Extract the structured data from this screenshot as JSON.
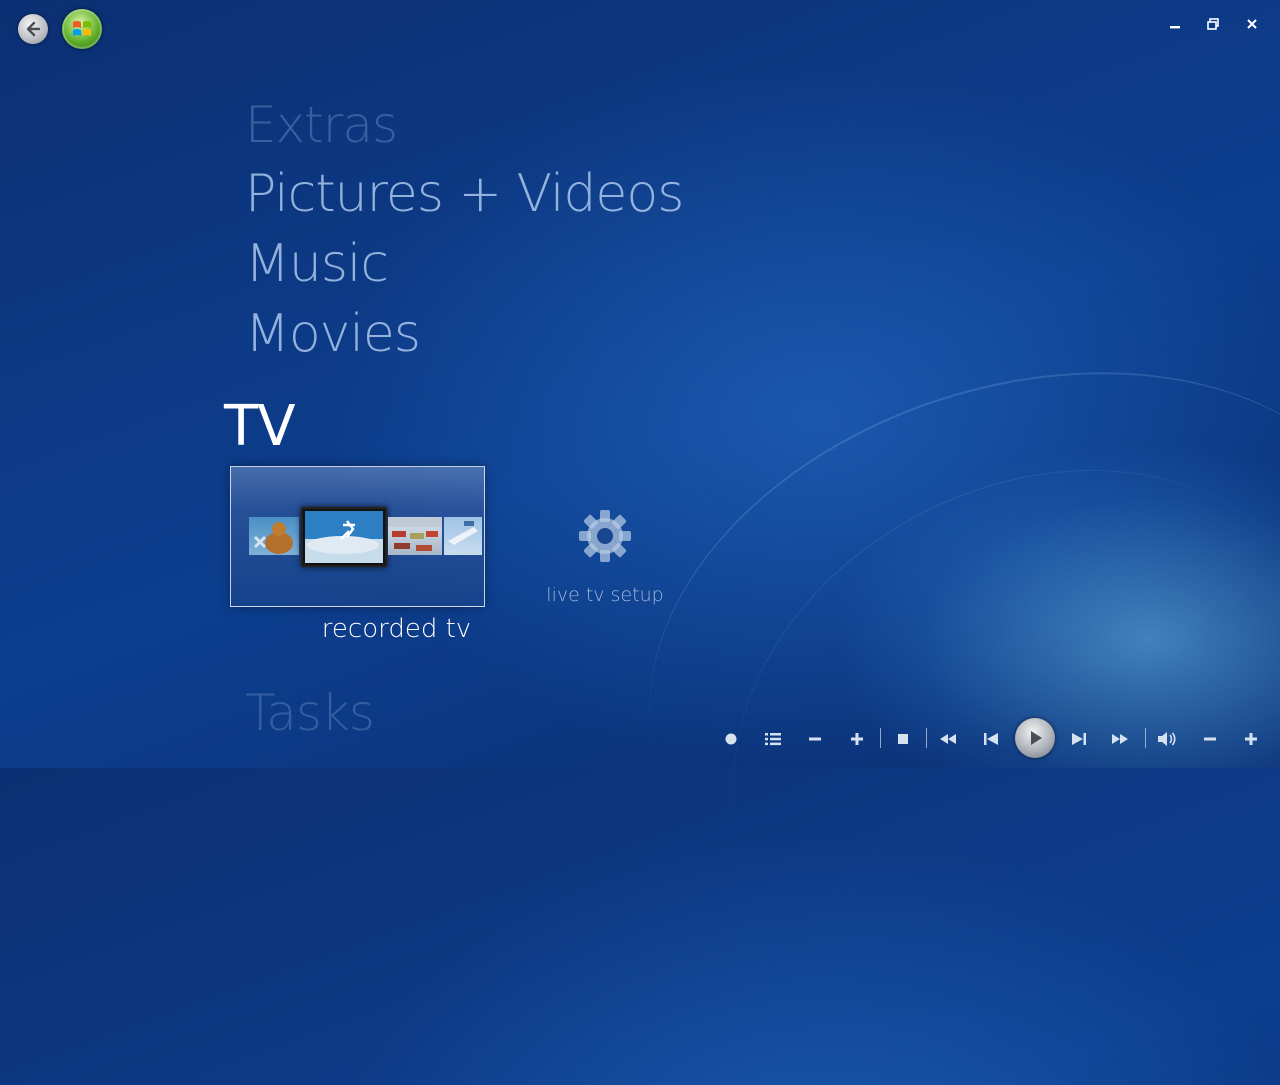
{
  "menu": {
    "items": [
      {
        "label": "Extras"
      },
      {
        "label": "Pictures + Videos"
      },
      {
        "label": "Music"
      },
      {
        "label": "Movies"
      },
      {
        "label": "TV"
      },
      {
        "label": "Tasks"
      }
    ],
    "selected": "TV"
  },
  "tv": {
    "tiles": [
      {
        "label": "recorded tv",
        "icon": "recorded-tv-thumbnails"
      },
      {
        "label": "live tv setup",
        "icon": "gear-icon"
      }
    ]
  },
  "window_controls": [
    "minimize-icon",
    "restore-icon",
    "close-icon"
  ],
  "nav": {
    "back_icon": "back-arrow-icon",
    "start_icon": "windows-start-orb-icon"
  },
  "transport": [
    "record-icon",
    "guide-list-icon",
    "channel-down-icon",
    "channel-up-icon",
    "stop-icon",
    "rewind-icon",
    "previous-icon",
    "play-icon",
    "next-icon",
    "fast-forward-icon",
    "mute-icon",
    "volume-down-icon",
    "volume-up-icon"
  ],
  "colors": {
    "background": "#0c3a86",
    "menu_inactive": "#aac8eb",
    "menu_selected": "#ffffff",
    "accent_green": "#5fb02b"
  }
}
